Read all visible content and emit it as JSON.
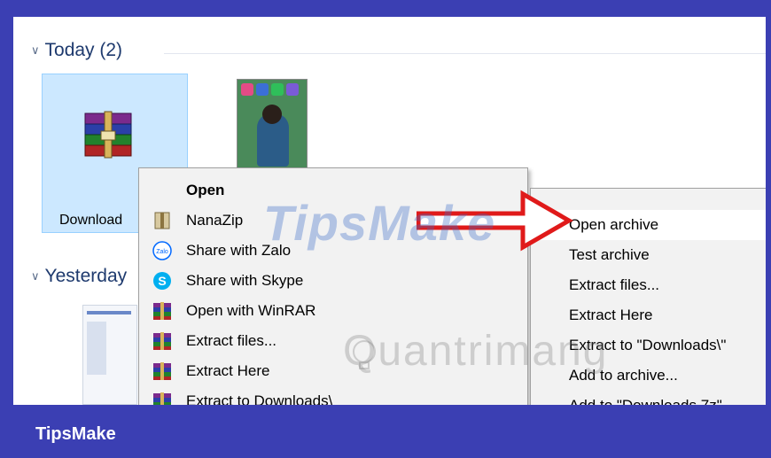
{
  "explorer": {
    "groups": [
      {
        "label": "Today (2)"
      },
      {
        "label": "Yesterday"
      }
    ],
    "files": [
      {
        "label": "Download"
      }
    ]
  },
  "context_menu": {
    "items": [
      {
        "label": "Open",
        "icon": "none",
        "bold": true
      },
      {
        "label": "NanaZip",
        "icon": "nanazip-icon",
        "has_submenu": true
      },
      {
        "label": "Share with Zalo",
        "icon": "zalo-icon"
      },
      {
        "label": "Share with Skype",
        "icon": "skype-icon"
      },
      {
        "label": "Open with WinRAR",
        "icon": "winrar-icon"
      },
      {
        "label": "Extract files...",
        "icon": "winrar-icon"
      },
      {
        "label": "Extract Here",
        "icon": "winrar-icon"
      },
      {
        "label": "Extract to Downloads\\",
        "icon": "winrar-icon"
      }
    ]
  },
  "submenu": {
    "items": [
      {
        "label": "Open archive"
      },
      {
        "label": "Test archive"
      },
      {
        "label": "Extract files..."
      },
      {
        "label": "Extract Here"
      },
      {
        "label": "Extract to \"Downloads\\\""
      },
      {
        "label": "Add to archive..."
      },
      {
        "label": "Add to \"Downloads.7z\""
      }
    ]
  },
  "watermarks": {
    "primary": "TipsMake",
    "secondary": "Quantrimang"
  },
  "footer": {
    "brand": "TipsMake"
  },
  "colors": {
    "frame_bg": "#3b3fb3",
    "selection": "#cce8ff",
    "arrow_red": "#e01a1a"
  }
}
